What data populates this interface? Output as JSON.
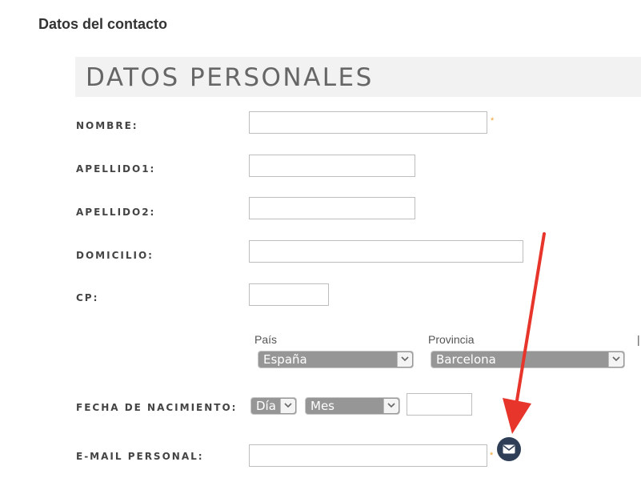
{
  "page": {
    "title": "Datos del contacto"
  },
  "section": {
    "title": "DATOS PERSONALES"
  },
  "fields": {
    "nombre": {
      "label": "NOMBRE:",
      "value": "",
      "required": "*"
    },
    "apellido1": {
      "label": "APELLIDO1:",
      "value": ""
    },
    "apellido2": {
      "label": "APELLIDO2:",
      "value": ""
    },
    "domicilio": {
      "label": "DOMICILIO:",
      "value": ""
    },
    "cp": {
      "label": "CP:",
      "value": ""
    },
    "fecha": {
      "label": "FECHA DE NACIMIENTO:",
      "day_value": "Día",
      "month_value": "Mes",
      "year_value": ""
    },
    "email": {
      "label": "E-MAIL PERSONAL:",
      "value": "",
      "required": "*"
    }
  },
  "location": {
    "pais_caption": "País",
    "pais_value": "España",
    "provincia_caption": "Provincia",
    "provincia_value": "Barcelona"
  },
  "icons": {
    "select_arrow": "chevron-down-icon",
    "email_button": "envelope-icon",
    "annotation": "red-arrow"
  },
  "colors": {
    "select_bg": "#969696",
    "email_button_bg": "#2f3e57",
    "required_star": "#f0a030",
    "annotation_arrow": "#e8352b"
  }
}
